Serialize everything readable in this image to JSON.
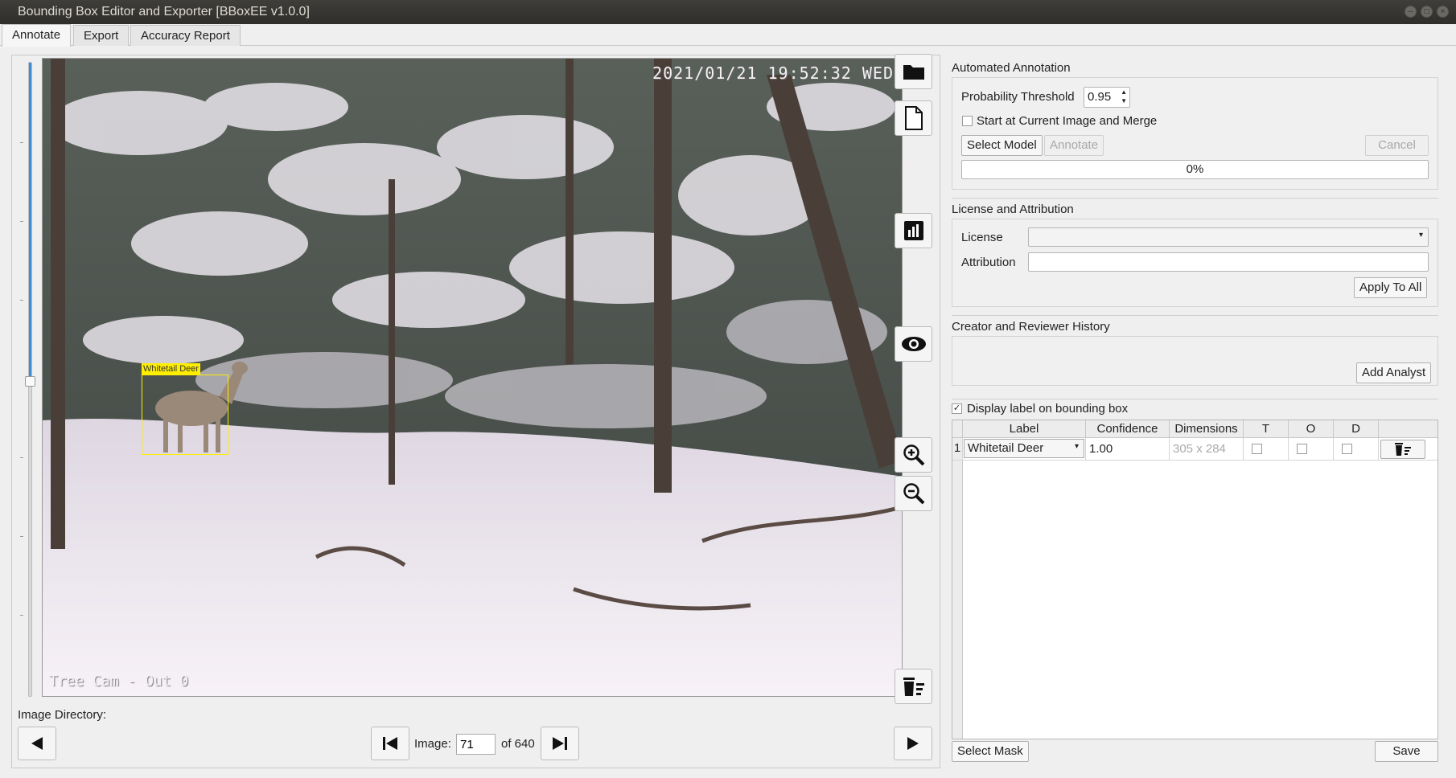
{
  "window": {
    "title": "Bounding Box Editor and Exporter [BBoxEE v1.0.0]"
  },
  "tabs": [
    {
      "label": "Annotate"
    },
    {
      "label": "Export"
    },
    {
      "label": "Accuracy Report"
    }
  ],
  "image": {
    "timestamp": "2021/01/21 19:52:32 WED",
    "camera_tag": "Tree Cam - Out 0",
    "bbox_label": "Whitetail Deer",
    "bbox_color": "#ffee00"
  },
  "navigation": {
    "directory_label": "Image Directory:",
    "image_label": "Image:",
    "image_value": "71",
    "of_label": "of 640"
  },
  "automated": {
    "section_title": "Automated Annotation",
    "threshold_label": "Probability Threshold",
    "threshold_value": "0.95",
    "merge_label": "Start at Current Image and Merge",
    "select_model": "Select Model",
    "annotate": "Annotate",
    "cancel": "Cancel",
    "progress_text": "0%",
    "progress": 0
  },
  "license": {
    "section_title": "License and Attribution",
    "license_label": "License",
    "license_value": "",
    "attribution_label": "Attribution",
    "attribution_value": "",
    "apply_all": "Apply To All"
  },
  "history": {
    "section_title": "Creator and Reviewer History",
    "add_analyst": "Add Analyst"
  },
  "labels": {
    "display_label": "Display label on bounding box",
    "display_checked": true,
    "columns": [
      "Label",
      "Confidence",
      "Dimensions",
      "T",
      "O",
      "D"
    ],
    "rows": [
      {
        "index": "1",
        "label": "Whitetail Deer",
        "confidence": "1.00",
        "dimensions": "305 x 284"
      }
    ]
  },
  "footer": {
    "select_mask": "Select Mask",
    "save": "Save"
  },
  "colors": {
    "accent": "#3c8fd6",
    "titlebar": "#33322f"
  },
  "icons": {
    "toolbar": [
      "folder-icon",
      "file-icon",
      "chart-icon",
      "eye-icon",
      "zoom-in-icon",
      "zoom-out-icon",
      "delete-all-icon"
    ],
    "nav": [
      "prev-icon",
      "first-icon",
      "last-icon",
      "next-icon"
    ]
  }
}
